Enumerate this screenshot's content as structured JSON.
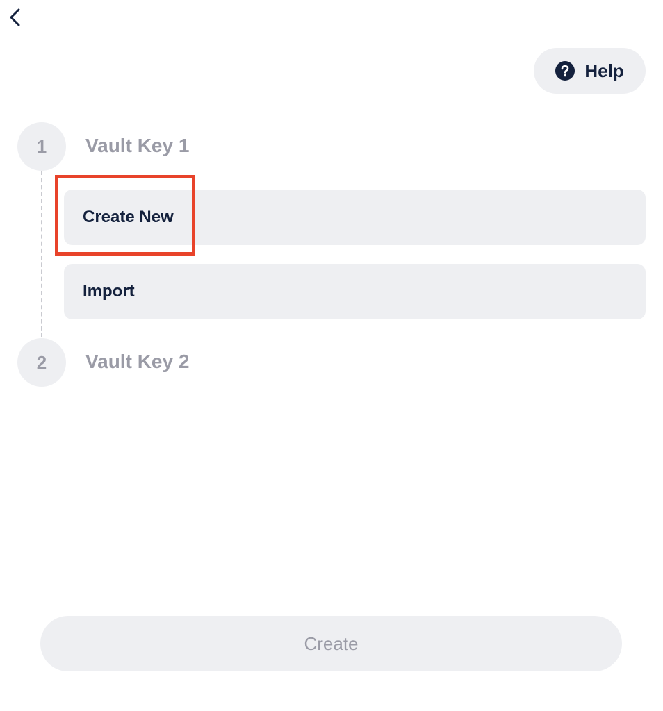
{
  "navigation": {
    "back_icon": "chevron-left-icon"
  },
  "help": {
    "icon": "question-circle-icon",
    "label": "Help"
  },
  "steps": [
    {
      "number": "1",
      "title": "Vault Key 1",
      "options": [
        {
          "label": "Create New",
          "highlighted": true
        },
        {
          "label": "Import",
          "highlighted": false
        }
      ]
    },
    {
      "number": "2",
      "title": "Vault Key 2"
    }
  ],
  "footer": {
    "create_label": "Create",
    "create_enabled": false
  },
  "colors": {
    "primary_text": "#14213d",
    "muted_text": "#9a9ba6",
    "surface": "#eeeff2",
    "highlight": "#e8432a"
  }
}
